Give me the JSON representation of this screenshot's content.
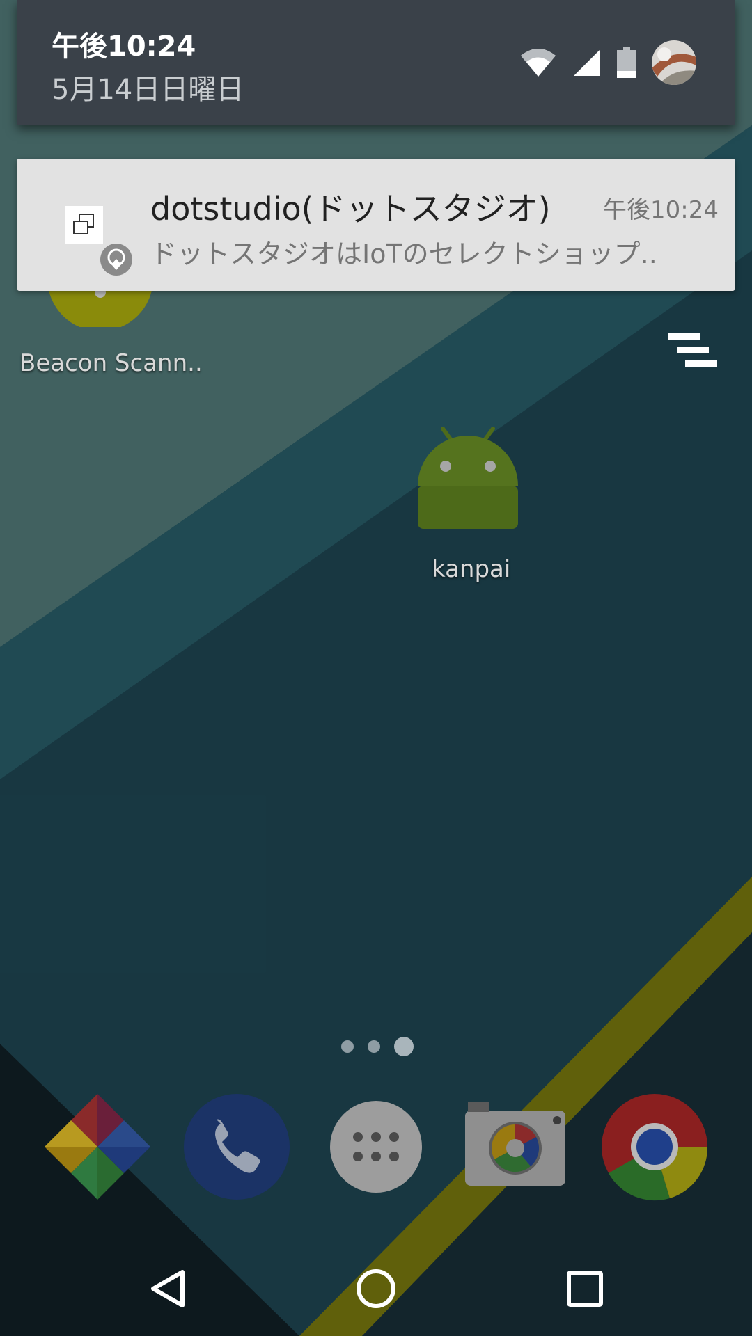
{
  "shade": {
    "time": "午後10:24",
    "date": "5月14日日曜日"
  },
  "notification": {
    "app_title": "dotstudio(ドットスタジオ)",
    "time": "午後10:24",
    "text": "ドットスタジオはIoTのセレクトショップ.."
  },
  "home": {
    "apps": [
      {
        "label": "Beacon Scann..",
        "icon": "beacon-scanner-icon"
      },
      {
        "label": "kanpai",
        "icon": "android-icon"
      }
    ],
    "dock": [
      {
        "icon": "photos-icon"
      },
      {
        "icon": "phone-icon"
      },
      {
        "icon": "app-drawer-icon"
      },
      {
        "icon": "camera-icon"
      },
      {
        "icon": "chrome-icon"
      }
    ],
    "page_count": 3,
    "active_page": 3
  },
  "navbar": [
    "back-icon",
    "home-icon",
    "recents-icon"
  ],
  "colors": {
    "shade_bg": "#3a4149",
    "notification_bg": "#e2e2e2",
    "wallpaper": "#1f3f4a"
  }
}
